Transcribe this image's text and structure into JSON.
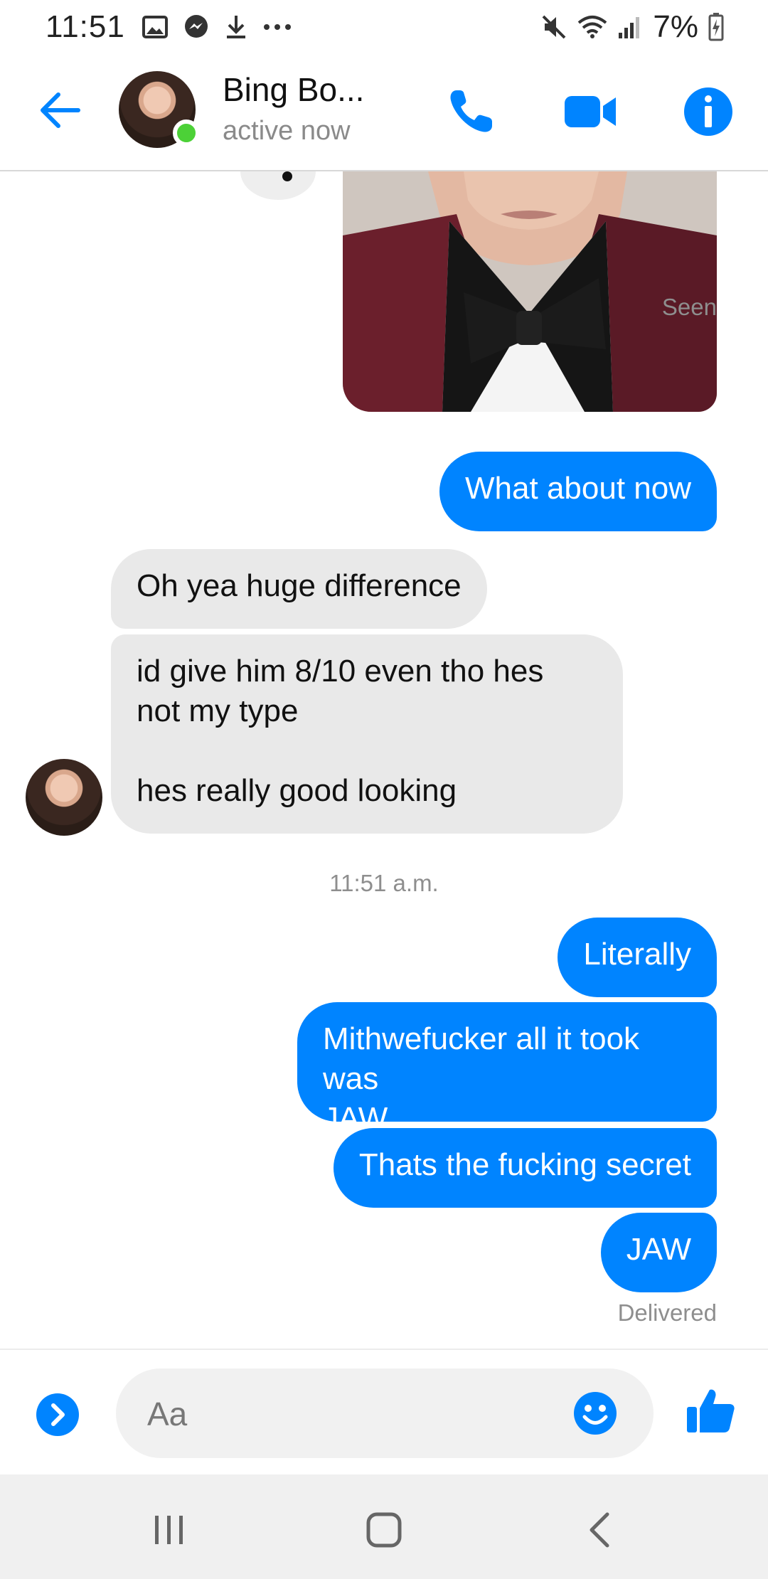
{
  "status_bar": {
    "time": "11:51",
    "battery_percent": "7%",
    "icons": [
      "gallery-icon",
      "messenger-icon",
      "download-icon",
      "more-icon",
      "mute-icon",
      "wifi-icon",
      "signal-icon",
      "battery-icon"
    ]
  },
  "header": {
    "contact_name": "Bing Bo...",
    "status": "active now",
    "icons": [
      "back-arrow-icon",
      "phone-icon",
      "video-icon",
      "info-icon"
    ]
  },
  "messages": {
    "seen_label": "Seen",
    "out_1": "What about now",
    "in_1": "Oh yea huge difference",
    "in_2": "id give him 8/10 even tho hes\nnot my type\n\nhes really good looking",
    "timestamp": "11:51 a.m.",
    "out_2": "Literally",
    "out_3": "Mithwefucker all it took was\nJAW",
    "out_4": "Thats the fucking secret",
    "out_5": "JAW",
    "delivered_label": "Delivered"
  },
  "composer": {
    "placeholder": "Aa",
    "icons": [
      "expand-icon",
      "emoji-icon",
      "thumbs-up-icon"
    ]
  },
  "colors": {
    "accent": "#0084ff",
    "incoming_bubble": "#e9e9e9",
    "active_green": "#4cd137"
  }
}
